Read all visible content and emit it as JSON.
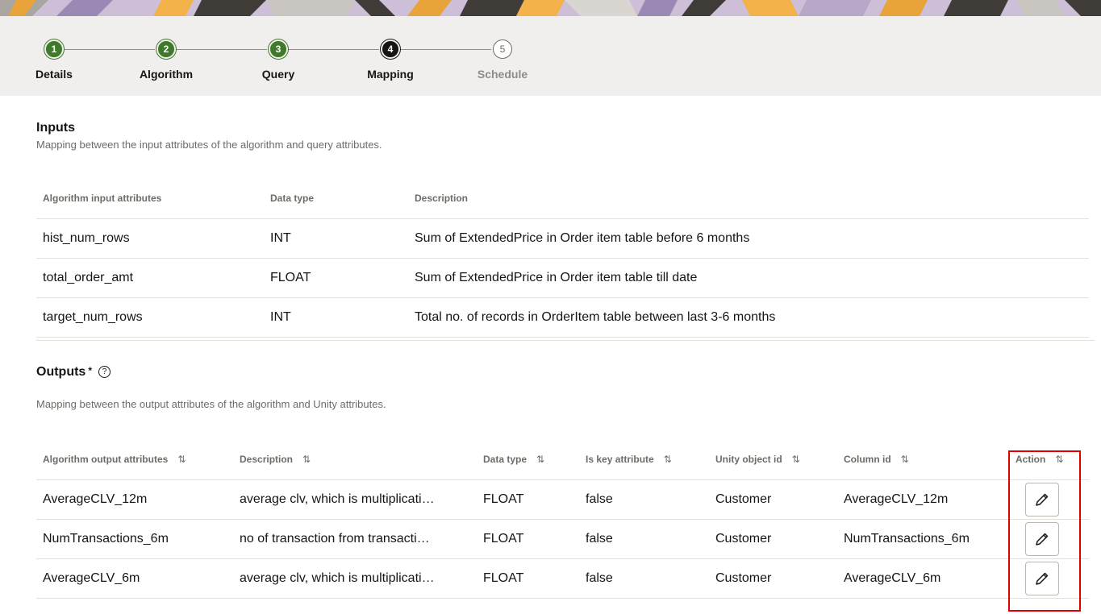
{
  "stepper": {
    "steps": [
      {
        "number": "1",
        "label": "Details",
        "state": "done"
      },
      {
        "number": "2",
        "label": "Algorithm",
        "state": "done"
      },
      {
        "number": "3",
        "label": "Query",
        "state": "done"
      },
      {
        "number": "4",
        "label": "Mapping",
        "state": "current"
      },
      {
        "number": "5",
        "label": "Schedule",
        "state": "todo"
      }
    ]
  },
  "inputs": {
    "title": "Inputs",
    "description": "Mapping between the input attributes of the algorithm and query attributes.",
    "columns": [
      "Algorithm input attributes",
      "Data type",
      "Description"
    ],
    "rows": [
      {
        "attr": "hist_num_rows",
        "type": "INT",
        "desc": "Sum of ExtendedPrice in Order item table before 6 months"
      },
      {
        "attr": "total_order_amt",
        "type": "FLOAT",
        "desc": "Sum of ExtendedPrice in Order item table till date"
      },
      {
        "attr": "target_num_rows",
        "type": "INT",
        "desc": "Total no. of records in OrderItem table between last 3-6 months"
      }
    ]
  },
  "outputs": {
    "title": "Outputs",
    "required_mark": "*",
    "help_icon": "question-circle-icon",
    "description": "Mapping between the output attributes of the algorithm and Unity attributes.",
    "columns": [
      "Algorithm output attributes",
      "Description",
      "Data type",
      "Is key attribute",
      "Unity object id",
      "Column id",
      "Action"
    ],
    "sort_icon": "⇅",
    "rows": [
      {
        "attr": "AverageCLV_12m",
        "desc": "average clv, which is multiplicati…",
        "type": "FLOAT",
        "key": "false",
        "object": "Customer",
        "column": "AverageCLV_12m"
      },
      {
        "attr": "NumTransactions_6m",
        "desc": "no of transaction from transacti…",
        "type": "FLOAT",
        "key": "false",
        "object": "Customer",
        "column": "NumTransactions_6m"
      },
      {
        "attr": "AverageCLV_6m",
        "desc": "average clv, which is multiplicati…",
        "type": "FLOAT",
        "key": "false",
        "object": "Customer",
        "column": "AverageCLV_6m"
      }
    ],
    "edit_icon": "pencil-icon"
  },
  "colors": {
    "step_done": "#3e7a29",
    "step_current": "#161513",
    "highlight_box": "#e00000"
  }
}
